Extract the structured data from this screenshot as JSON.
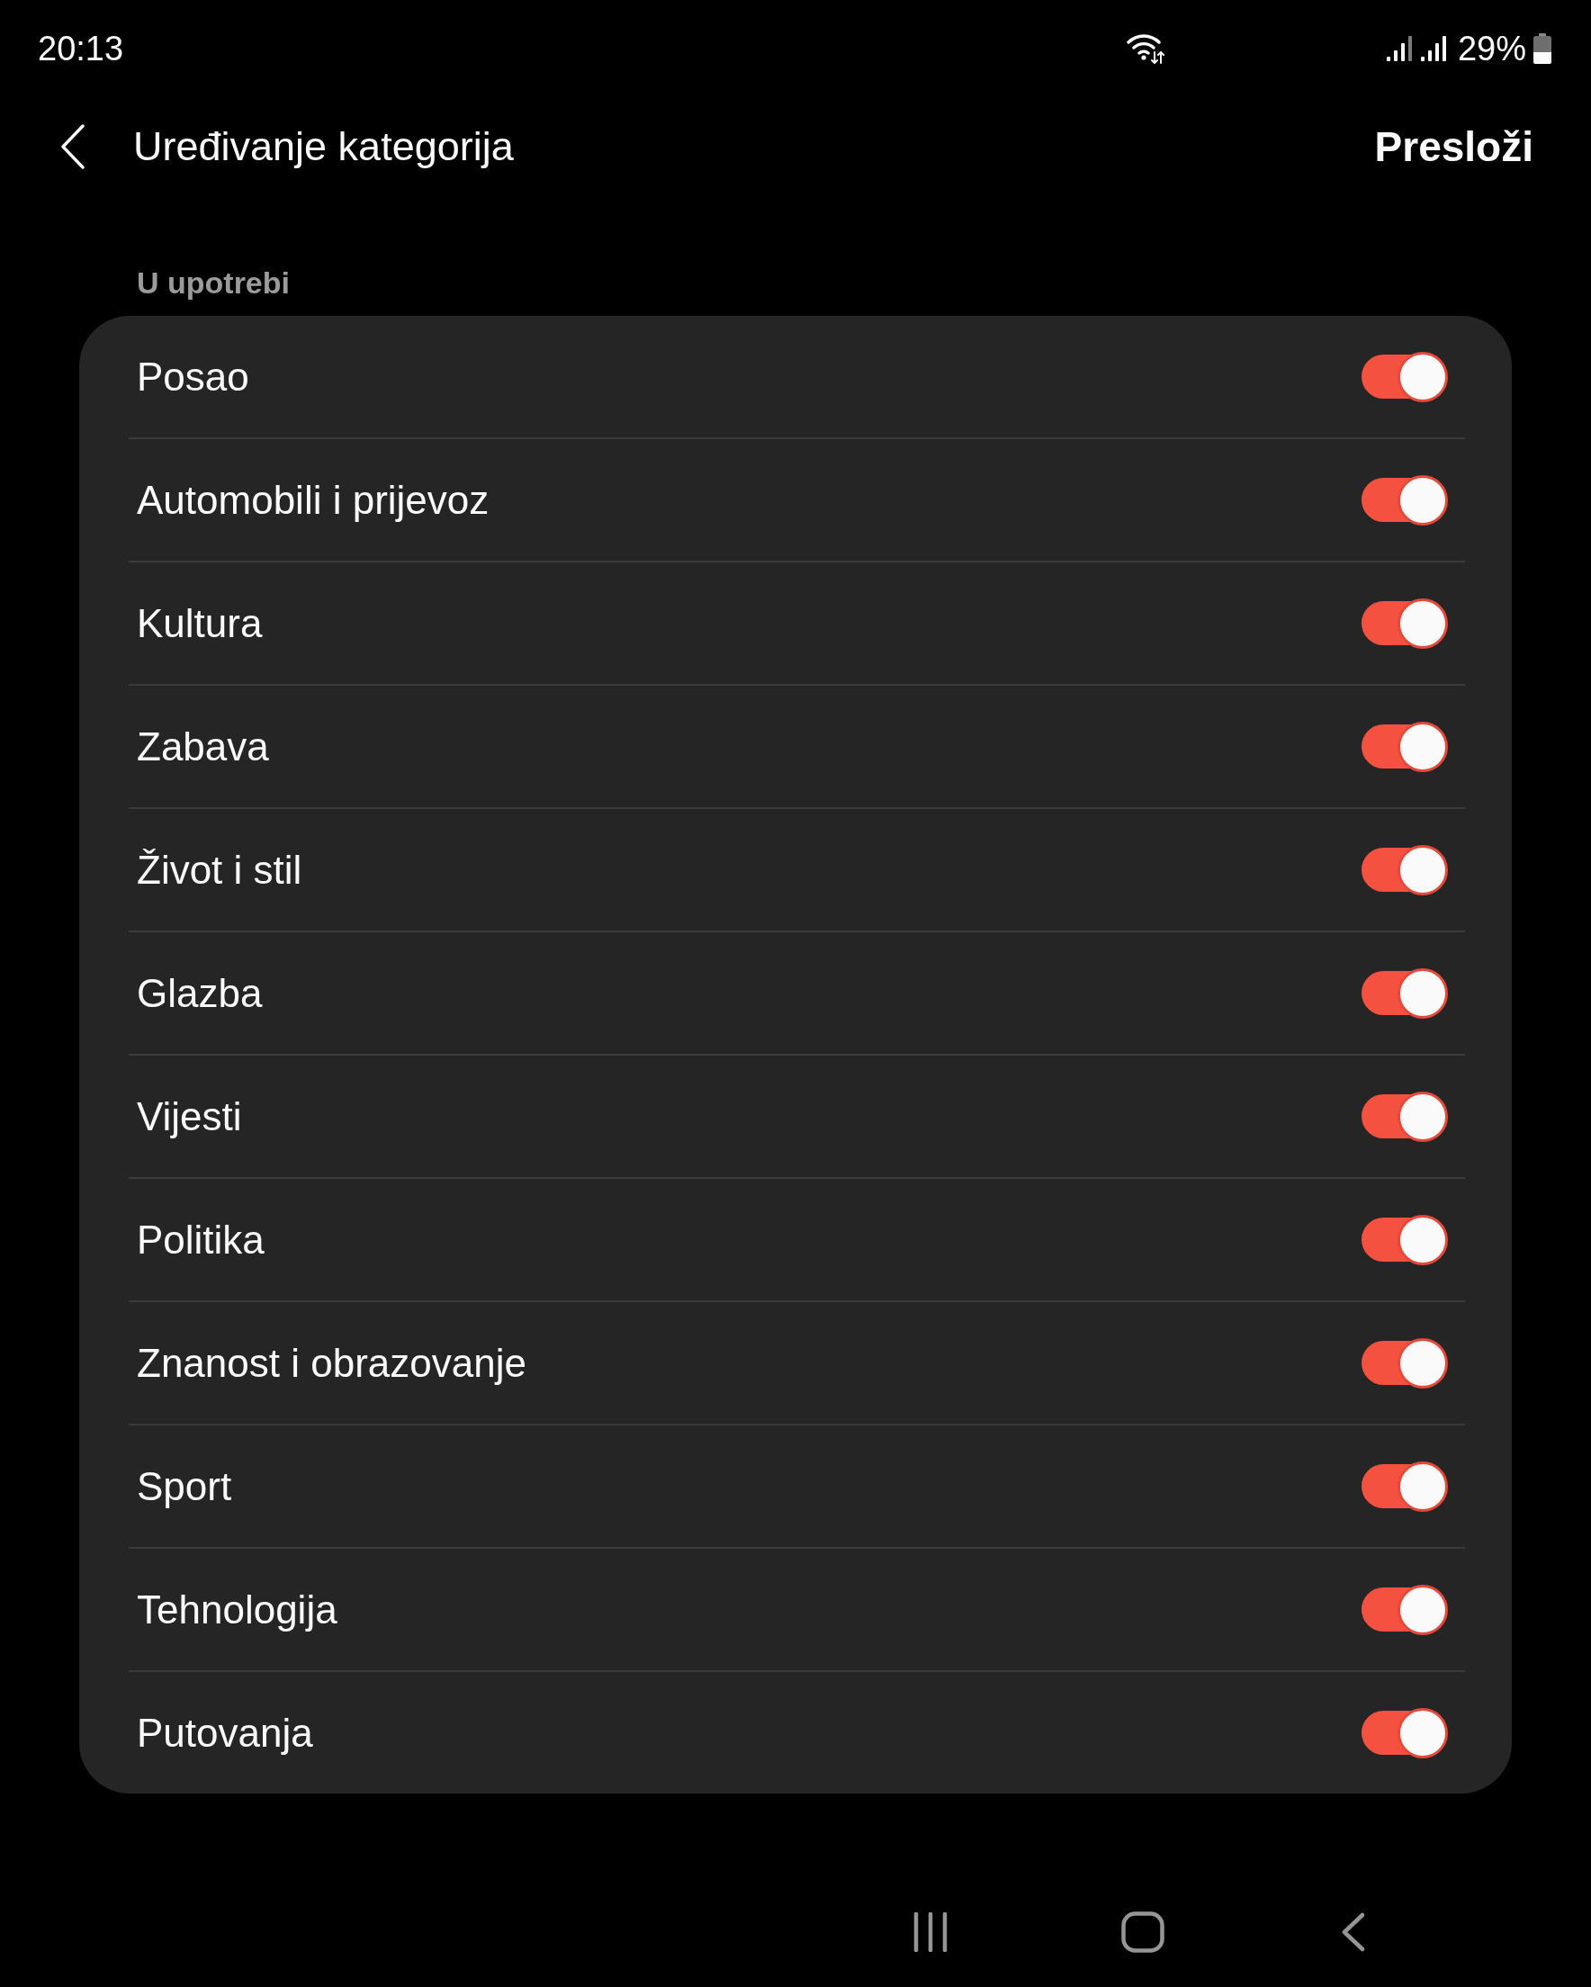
{
  "status_bar": {
    "time": "20:13",
    "battery": "29%"
  },
  "header": {
    "title": "Uređivanje kategorija",
    "action": "Presloži"
  },
  "section": {
    "title": "U upotrebi",
    "items": [
      {
        "label": "Posao",
        "on": true
      },
      {
        "label": "Automobili i prijevoz",
        "on": true
      },
      {
        "label": "Kultura",
        "on": true
      },
      {
        "label": "Zabava",
        "on": true
      },
      {
        "label": "Život i stil",
        "on": true
      },
      {
        "label": "Glazba",
        "on": true
      },
      {
        "label": "Vijesti",
        "on": true
      },
      {
        "label": "Politika",
        "on": true
      },
      {
        "label": "Znanost i obrazovanje",
        "on": true
      },
      {
        "label": "Sport",
        "on": true
      },
      {
        "label": "Tehnologija",
        "on": true
      },
      {
        "label": "Putovanja",
        "on": true
      }
    ]
  }
}
